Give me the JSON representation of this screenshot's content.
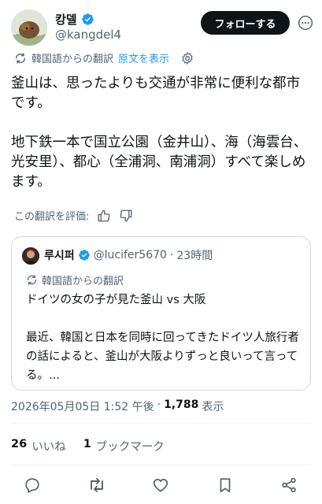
{
  "author": {
    "display_name": "캉델",
    "handle": "@kangdel4",
    "follow_label": "フォローする"
  },
  "translation": {
    "source_label": "韓国語からの翻訳",
    "show_original": "原文を表示"
  },
  "tweet": {
    "text": "釜山は、思ったよりも交通が非常に便利な都市です。\n\n地下鉄一本で国立公園（金井山）、海（海雲台、光安里）、都心（全浦洞、南浦洞）すべて楽しめます。"
  },
  "rate": {
    "label": "この翻訳を評価:"
  },
  "quote": {
    "display_name": "루시퍼",
    "handle": "@lucifer5670",
    "separator": "·",
    "time": "23時間",
    "translation_label": "韓国語からの翻訳",
    "text": "ドイツの女の子が見た釜山 vs 大阪\n\n最近、韓国と日本を同時に回ってきたドイツ人旅行者の話によると、釜山が大阪よりずっと良いって言ってる。..."
  },
  "meta": {
    "timestamp": "2026年05月05日 1:52 午後",
    "dot": "·",
    "views_count": "1,788",
    "views_label": "表示"
  },
  "stats": {
    "likes_count": "26",
    "likes_label": "いいね",
    "bookmarks_count": "1",
    "bookmarks_label": "ブックマーク"
  },
  "colors": {
    "accent": "#1d9bf0",
    "text": "#0f1419",
    "secondary": "#536471",
    "border": "#cfd9de"
  },
  "icons": [
    "verified-icon",
    "more-icon",
    "translate-icon",
    "gear-icon",
    "thumbs-up-icon",
    "thumbs-down-icon",
    "reply-icon",
    "retweet-icon",
    "like-icon",
    "bookmark-icon",
    "share-icon"
  ]
}
